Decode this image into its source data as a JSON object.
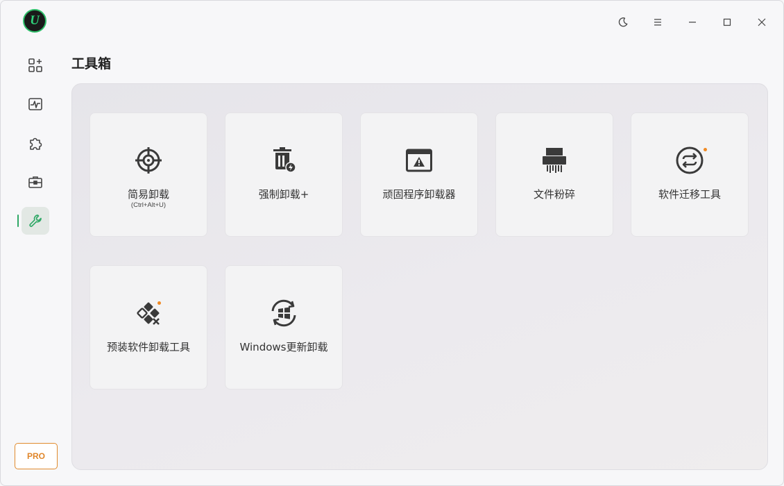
{
  "app": {
    "logo_letter": "U",
    "accent": "#2fa866",
    "pro_color": "#e0862a"
  },
  "sidebar": {
    "items": [
      {
        "name": "apps",
        "icon": "apps-grid-icon"
      },
      {
        "name": "performance",
        "icon": "activity-monitor-icon"
      },
      {
        "name": "plugins",
        "icon": "puzzle-icon"
      },
      {
        "name": "toolbox-case",
        "icon": "briefcase-icon"
      },
      {
        "name": "tools",
        "icon": "wrench-icon",
        "active": true
      }
    ],
    "pro_label": "PRO"
  },
  "titlebar": {
    "buttons": [
      "moon-icon",
      "menu-icon",
      "minimize-icon",
      "maximize-icon",
      "close-icon"
    ]
  },
  "page": {
    "title": "工具箱"
  },
  "tools": [
    {
      "label": "简易卸载",
      "sub": "(Ctrl+Alt+U)",
      "icon": "crosshair-icon",
      "new": false
    },
    {
      "label": "强制卸载+",
      "icon": "trash-bolt-icon",
      "new": false
    },
    {
      "label": "顽固程序卸载器",
      "icon": "window-warning-icon",
      "new": false
    },
    {
      "label": "文件粉碎",
      "icon": "shredder-icon",
      "new": false
    },
    {
      "label": "软件迁移工具",
      "icon": "sync-circle-icon",
      "new": true
    },
    {
      "label": "预装软件卸载工具",
      "icon": "diamond-remove-icon",
      "new": true
    },
    {
      "label": "Windows更新卸载",
      "icon": "windows-update-icon",
      "new": false
    }
  ]
}
